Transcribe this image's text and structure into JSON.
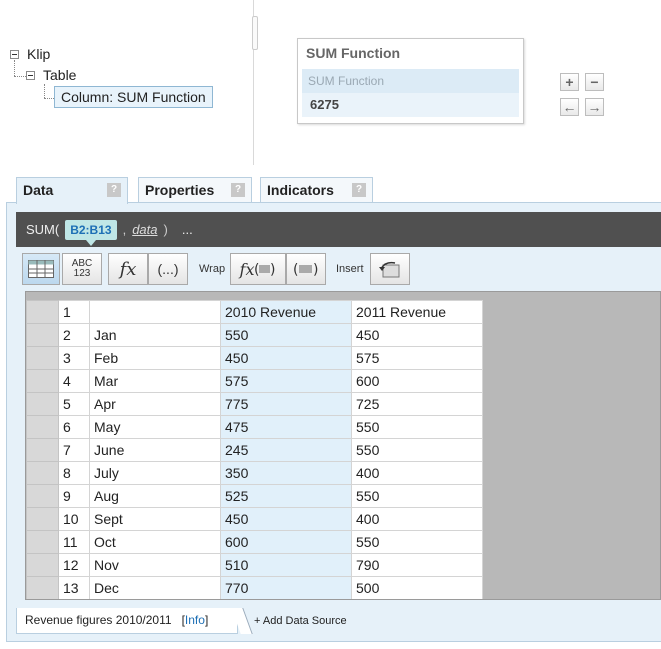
{
  "tree": {
    "root": "Klip",
    "child": "Table",
    "selected": "Column: SUM Function"
  },
  "preview": {
    "title": "SUM Function",
    "column_header": "SUM Function",
    "value": "6275"
  },
  "tabs": [
    {
      "label": "Data",
      "help": "?"
    },
    {
      "label": "Properties",
      "help": "?"
    },
    {
      "label": "Indicators",
      "help": "?"
    }
  ],
  "formula": {
    "func": "SUM(",
    "range": "B2:B13",
    "comma": ",",
    "arg": "data",
    "close": ")",
    "more": "..."
  },
  "toolbar": {
    "abc_top": "ABC",
    "abc_bottom": "123",
    "fx": "fx",
    "paren": "(...)",
    "wrap_label": "Wrap",
    "insert_label": "Insert"
  },
  "grid": {
    "rows": [
      {
        "n": "1",
        "a": "",
        "b": "2010 Revenue",
        "c": "2011 Revenue"
      },
      {
        "n": "2",
        "a": "Jan",
        "b": "550",
        "c": "450"
      },
      {
        "n": "3",
        "a": "Feb",
        "b": "450",
        "c": "575"
      },
      {
        "n": "4",
        "a": "Mar",
        "b": "575",
        "c": "600"
      },
      {
        "n": "5",
        "a": "Apr",
        "b": "775",
        "c": "725"
      },
      {
        "n": "6",
        "a": "May",
        "b": "475",
        "c": "550"
      },
      {
        "n": "7",
        "a": "June",
        "b": "245",
        "c": "550"
      },
      {
        "n": "8",
        "a": "July",
        "b": "350",
        "c": "400"
      },
      {
        "n": "9",
        "a": "Aug",
        "b": "525",
        "c": "550"
      },
      {
        "n": "10",
        "a": "Sept",
        "b": "450",
        "c": "400"
      },
      {
        "n": "11",
        "a": "Oct",
        "b": "600",
        "c": "550"
      },
      {
        "n": "12",
        "a": "Nov",
        "b": "510",
        "c": "790"
      },
      {
        "n": "13",
        "a": "Dec",
        "b": "770",
        "c": "500"
      }
    ]
  },
  "footer": {
    "source": "Revenue figures 2010/2011",
    "info_open": "[",
    "info": "Info",
    "info_close": "]",
    "add": "+ Add Data Source"
  },
  "colors": {
    "accent": "#1d6fb5",
    "panel_bg": "#e6f1f9",
    "formula_bg": "#505050",
    "selected_col": "#e1f0fa"
  }
}
